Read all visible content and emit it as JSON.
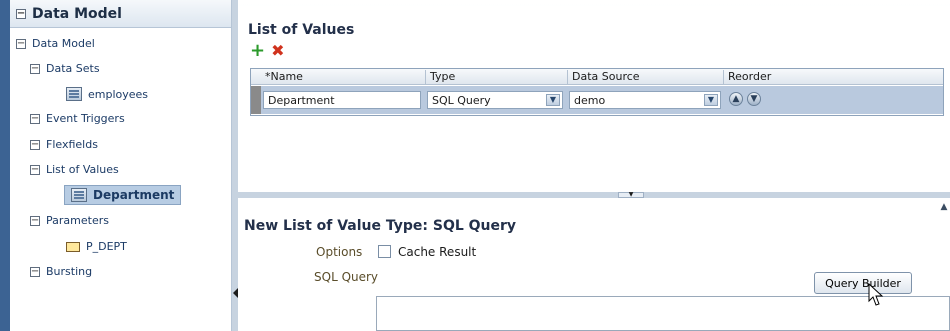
{
  "sidebar": {
    "header": "Data Model",
    "items": [
      {
        "label": "Data Model"
      },
      {
        "label": "Data Sets"
      },
      {
        "label": "employees"
      },
      {
        "label": "Event Triggers"
      },
      {
        "label": "Flexfields"
      },
      {
        "label": "List of Values"
      },
      {
        "label": "Department"
      },
      {
        "label": "Parameters"
      },
      {
        "label": "P_DEPT"
      },
      {
        "label": "Bursting"
      }
    ]
  },
  "lov": {
    "title": "List of Values",
    "columns": [
      {
        "label": "*Name"
      },
      {
        "label": "Type"
      },
      {
        "label": "Data Source"
      },
      {
        "label": "Reorder"
      }
    ],
    "row": {
      "name": "Department",
      "type": "SQL Query",
      "data_source": "demo"
    }
  },
  "detail": {
    "title": "New List of Value Type: SQL Query",
    "options_label": "Options",
    "cache_label": "Cache Result",
    "sql_label": "SQL Query",
    "query_builder_label": "Query Builder"
  },
  "icons": {
    "add": "add-icon",
    "delete": "delete-icon",
    "move_up": "move-up-icon",
    "move_down": "move-down-icon",
    "cursor": "cursor-icon"
  },
  "colors": {
    "accent": "#3c6393",
    "selected": "#b7cce3",
    "row_highlight": "#b9c9de"
  }
}
